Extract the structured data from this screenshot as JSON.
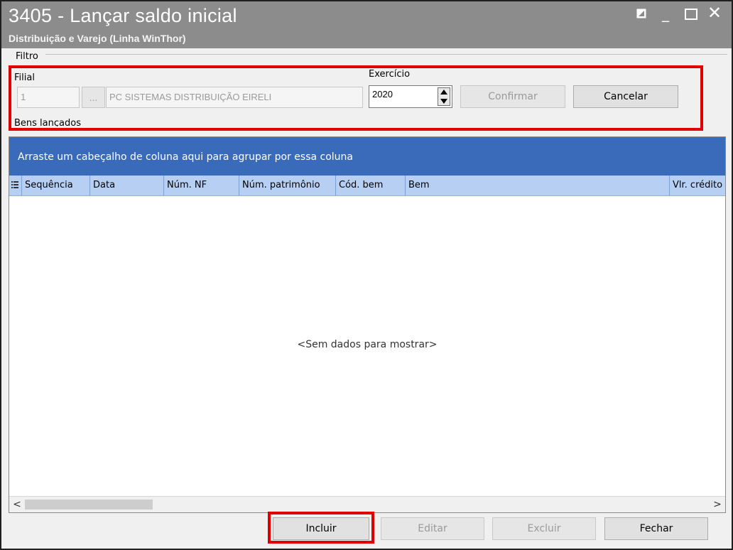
{
  "window": {
    "title": "3405 - Lançar saldo inicial",
    "subtitle": "Distribuição e Varejo (Linha WinThor)",
    "controls": {
      "restore": "◪",
      "minimize": "_",
      "close": "✕"
    }
  },
  "filtro": {
    "group_label": "Filtro",
    "filial_label": "Filial",
    "filial_code": "1",
    "filial_lookup_label": "...",
    "filial_name": "PC SISTEMAS DISTRIBUIÇÃO  EIRELI",
    "exercicio_label": "Exercício",
    "exercicio_value": "2020",
    "confirm_label": "Confirmar",
    "cancel_label": "Cancelar"
  },
  "bens": {
    "group_label": "Bens lançados",
    "group_panel_text": "Arraste um cabeçalho de coluna aqui para agrupar por essa coluna",
    "columns": [
      "Sequência",
      "Data",
      "Núm. NF",
      "Núm. patrimônio",
      "Cód. bem",
      "Bem",
      "Vlr. crédito"
    ],
    "empty_text": "<Sem dados para mostrar>",
    "scroll_left": "<",
    "scroll_right": ">"
  },
  "footer": {
    "incluir_label": "Incluir",
    "editar_label": "Editar",
    "excluir_label": "Excluir",
    "fechar_label": "Fechar"
  },
  "colors": {
    "title_bar": "#8c8c8c",
    "group_panel": "#3a6bbb",
    "header_row": "#b7cff2",
    "highlight": "#e00000"
  }
}
